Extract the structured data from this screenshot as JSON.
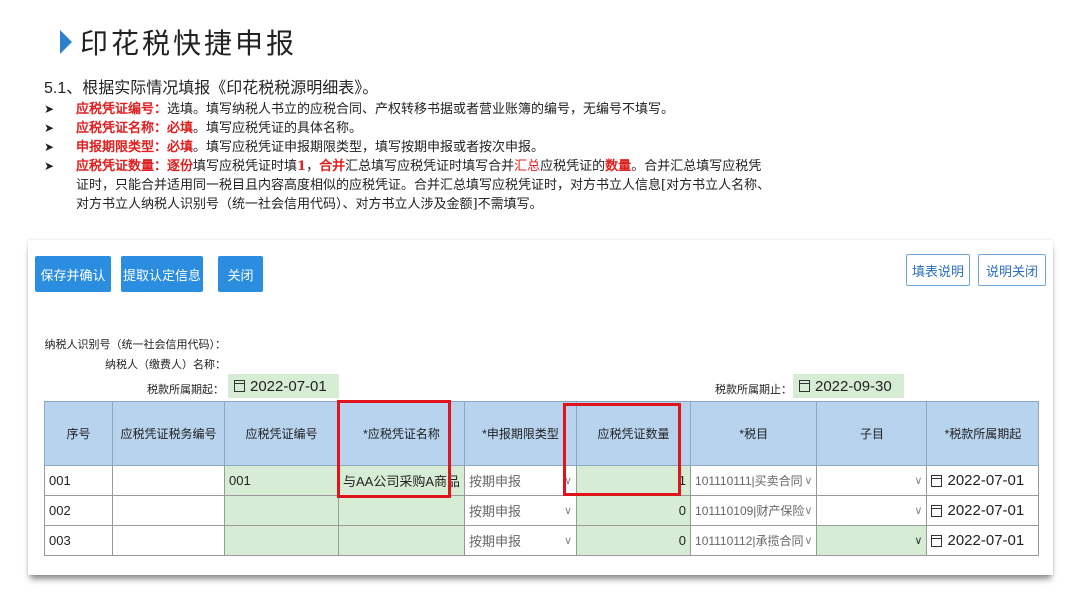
{
  "slide": {
    "title": "印花税快捷申报",
    "subtitle": "5.1、根据实际情况填报《印花税税源明细表》。",
    "bullets": [
      {
        "label": "应税凭证编号：",
        "req": "",
        "text": "选填。填写纳税人书立的应税合同、产权转移书据或者营业账簿的编号，无编号不填写。"
      },
      {
        "label": "应税凭证名称：",
        "req": "必填",
        "text": "。填写应税凭证的具体名称。"
      },
      {
        "label": "申报期限类型：",
        "req": "必填",
        "text": "。填写应税凭证申报期限类型，填写按期申报或者按次申报。"
      }
    ],
    "bullet4": {
      "label": "应税凭证数量：",
      "p1": "逐份",
      "p2": "填写应税凭证时填",
      "p3": "1",
      "p4": "，",
      "p5": "合并",
      "p6": "汇总填写应税凭证时填写合并",
      "p7": "汇总",
      "p8": "应税凭证的",
      "p9": "数量",
      "p10": "。合并汇总填写应税凭",
      "line2": "证时，只能合并适用同一税目且内容高度相似的应税凭证。合并汇总填写应税凭证时，对方书立人信息[对方书立人名称、",
      "line3": "对方书立人纳税人识别号（统一社会信用代码）、对方书立人涉及金额]不需填写。"
    }
  },
  "toolbar": {
    "save": "保存并确认",
    "fetch": "提取认定信息",
    "close": "关闭",
    "fill_help": "填表说明",
    "help_close": "说明关闭"
  },
  "form": {
    "taxpayer_id_label": "纳税人识别号（统一社会信用代码）：",
    "taxpayer_name_label": "纳税人（缴费人）名称：",
    "period_start_label": "税款所属期起：",
    "period_start": "2022-07-01",
    "period_end_label": "税款所属期止：",
    "period_end": "2022-09-30"
  },
  "table": {
    "headers": [
      "序号",
      "应税凭证税务编号",
      "应税凭证编号",
      "*应税凭证名称",
      "*申报期限类型",
      "应税凭证数量",
      "*税目",
      "子目",
      "*税款所属期起"
    ],
    "rows": [
      {
        "seq": "001",
        "tax_no": "",
        "cert_no": "001",
        "name": "与AA公司采购A商品",
        "period_type": "按期申报",
        "qty": "1",
        "item": "101110111|买卖合同",
        "sub": "",
        "start": "2022-07-01"
      },
      {
        "seq": "002",
        "tax_no": "",
        "cert_no": "",
        "name": "",
        "period_type": "按期申报",
        "qty": "0",
        "item": "101110109|财产保险",
        "sub": "",
        "start": "2022-07-01"
      },
      {
        "seq": "003",
        "tax_no": "",
        "cert_no": "",
        "name": "",
        "period_type": "按期申报",
        "qty": "0",
        "item": "101110112|承揽合同",
        "sub": "",
        "start": "2022-07-01"
      }
    ]
  },
  "icons": {
    "calendar": "calendar-icon",
    "dropdown": "chevron-down-icon",
    "title_marker": "triangle-right-icon"
  },
  "colors": {
    "accent": "#2b8de0",
    "highlight": "#e0141c",
    "required": "#e02020",
    "header_bg": "#b7d3ee",
    "editable_bg": "#d6ecd4"
  }
}
